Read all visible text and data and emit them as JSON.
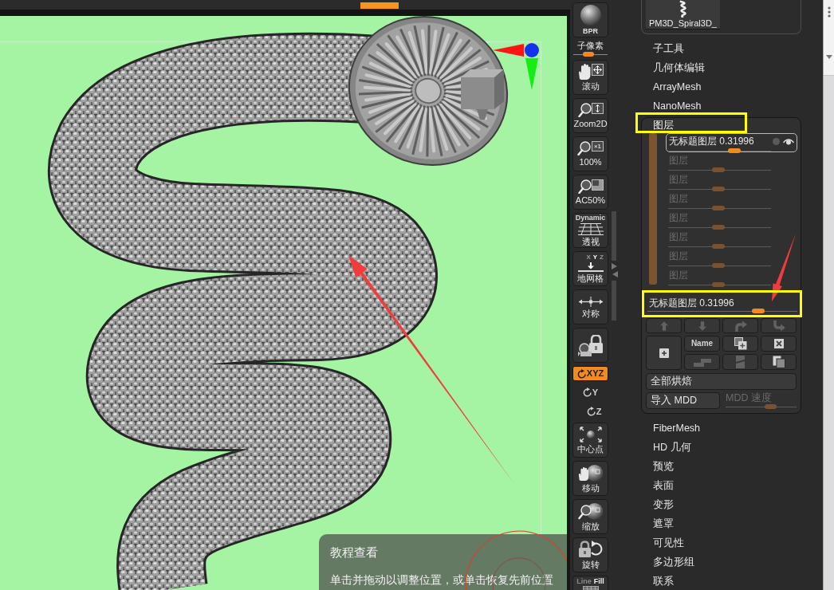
{
  "viewport": {
    "tooltip": {
      "title": "教程查看",
      "text": "单击并拖动以调整位置，或单击恢复先前位置"
    }
  },
  "toolbar": {
    "items": [
      {
        "kind": "button",
        "label": "BPR"
      },
      {
        "kind": "slider",
        "label": "子像素",
        "level": 0.41
      },
      {
        "kind": "button",
        "label": "滚动"
      },
      {
        "kind": "button",
        "label": "Zoom2D"
      },
      {
        "kind": "button",
        "label": "100%",
        "badge": "×1"
      },
      {
        "kind": "button",
        "label": "AC50%"
      },
      {
        "kind": "button",
        "label": "透视",
        "caption": "Dynamic"
      },
      {
        "kind": "button",
        "label": "地网格",
        "axes": [
          {
            "label": "X",
            "on": false
          },
          {
            "label": "Y",
            "on": true
          },
          {
            "label": "Z",
            "on": false
          }
        ]
      },
      {
        "kind": "button",
        "label": "对称"
      },
      {
        "kind": "button"
      },
      {
        "kind": "toggle",
        "label": "XYZ",
        "selected": true
      },
      {
        "kind": "toggle",
        "label": "Y",
        "selected": false
      },
      {
        "kind": "toggle",
        "label": "Z",
        "selected": false
      },
      {
        "kind": "button",
        "label": "中心点"
      },
      {
        "kind": "button",
        "label": "移动"
      },
      {
        "kind": "button",
        "label": "缩放"
      },
      {
        "kind": "button",
        "label": "旋转"
      },
      {
        "kind": "modes",
        "options": [
          {
            "label": "Line",
            "on": false
          },
          {
            "label": "Fill",
            "on": true
          }
        ]
      }
    ]
  },
  "panel": {
    "subtool": {
      "label": "PM3D_Spiral3D_"
    },
    "menu": [
      {
        "label": "子工具"
      },
      {
        "label": "几何体编辑"
      },
      {
        "label": "ArrayMesh"
      },
      {
        "label": "NanoMesh"
      }
    ],
    "layers": {
      "title": "图层",
      "rows": [
        {
          "label": "无标题图层 0.31996",
          "selected": true,
          "disabled": false,
          "level": 0.66
        },
        {
          "label": "图层",
          "selected": false,
          "disabled": true,
          "level": 0.49
        },
        {
          "label": "图层",
          "selected": false,
          "disabled": true,
          "level": 0.49
        },
        {
          "label": "图层",
          "selected": false,
          "disabled": true,
          "level": 0.49
        },
        {
          "label": "图层",
          "selected": false,
          "disabled": true,
          "level": 0.49
        },
        {
          "label": "图层",
          "selected": false,
          "disabled": true,
          "level": 0.49
        },
        {
          "label": "图层",
          "selected": false,
          "disabled": true,
          "level": 0.49
        },
        {
          "label": "图层",
          "selected": false,
          "disabled": true,
          "level": 0.49
        }
      ],
      "current": {
        "label": "无标题图层 0.31996",
        "level": 0.76
      },
      "buttons": [
        {
          "kind": "icon",
          "disabled": true
        },
        {
          "kind": "icon",
          "disabled": true
        },
        {
          "kind": "icon",
          "disabled": true
        },
        {
          "kind": "icon",
          "disabled": true
        },
        {
          "kind": "icon",
          "disabled": false
        },
        {
          "kind": "text",
          "label": "Name",
          "disabled": false
        },
        {
          "kind": "icon",
          "disabled": false
        },
        {
          "kind": "icon",
          "disabled": false
        },
        {
          "kind": "icon",
          "disabled": true
        },
        {
          "kind": "icon",
          "disabled": true
        },
        {
          "kind": "icon",
          "disabled": false
        }
      ],
      "bake_all": {
        "label": "全部烘焙"
      },
      "import_mdd": {
        "label": "导入 MDD"
      },
      "mdd_speed": {
        "label": "MDD 速度",
        "level": 0.66,
        "disabled": true
      }
    },
    "menu_more": [
      {
        "label": "FiberMesh"
      },
      {
        "label": "HD 几何"
      },
      {
        "label": "预览"
      },
      {
        "label": "表面"
      },
      {
        "label": "变形"
      },
      {
        "label": "遮罩"
      },
      {
        "label": "可见性"
      },
      {
        "label": "多边形组"
      },
      {
        "label": "联系"
      }
    ]
  }
}
